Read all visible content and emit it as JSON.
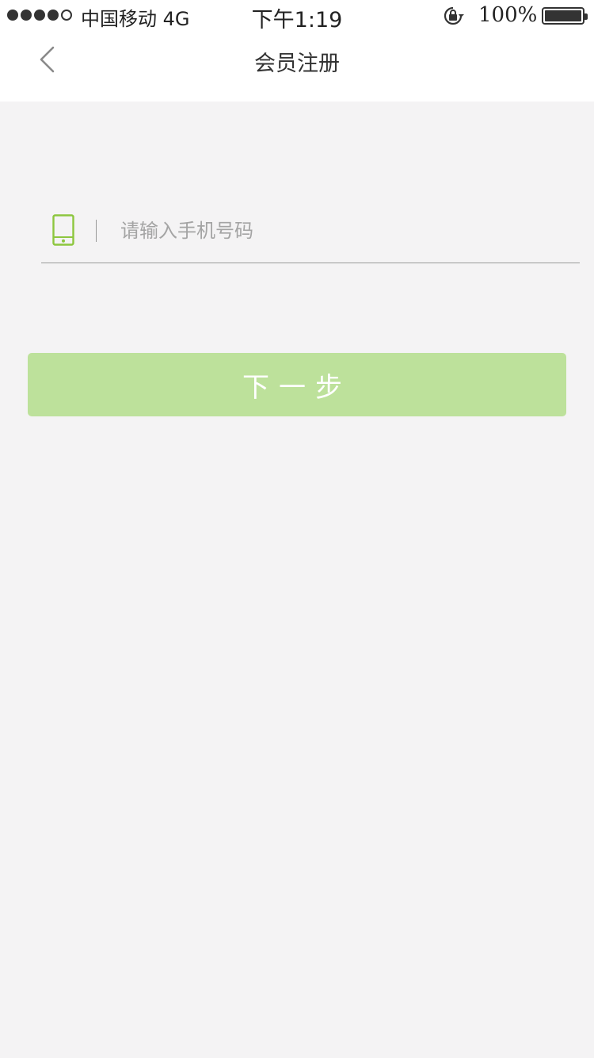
{
  "status_bar": {
    "carrier": "中国移动  4G",
    "time": "下午1:19",
    "battery": "100%",
    "signal_strength": 4
  },
  "nav": {
    "title": "会员注册",
    "back_icon": "chevron-left-icon"
  },
  "form": {
    "phone_icon": "mobile-phone-icon",
    "phone_placeholder": "请输入手机号码",
    "phone_value": ""
  },
  "next_button": {
    "label": "下一步"
  },
  "colors": {
    "accent": "#8dc63f",
    "button_disabled": "#bde19b",
    "background": "#f4f3f4"
  }
}
